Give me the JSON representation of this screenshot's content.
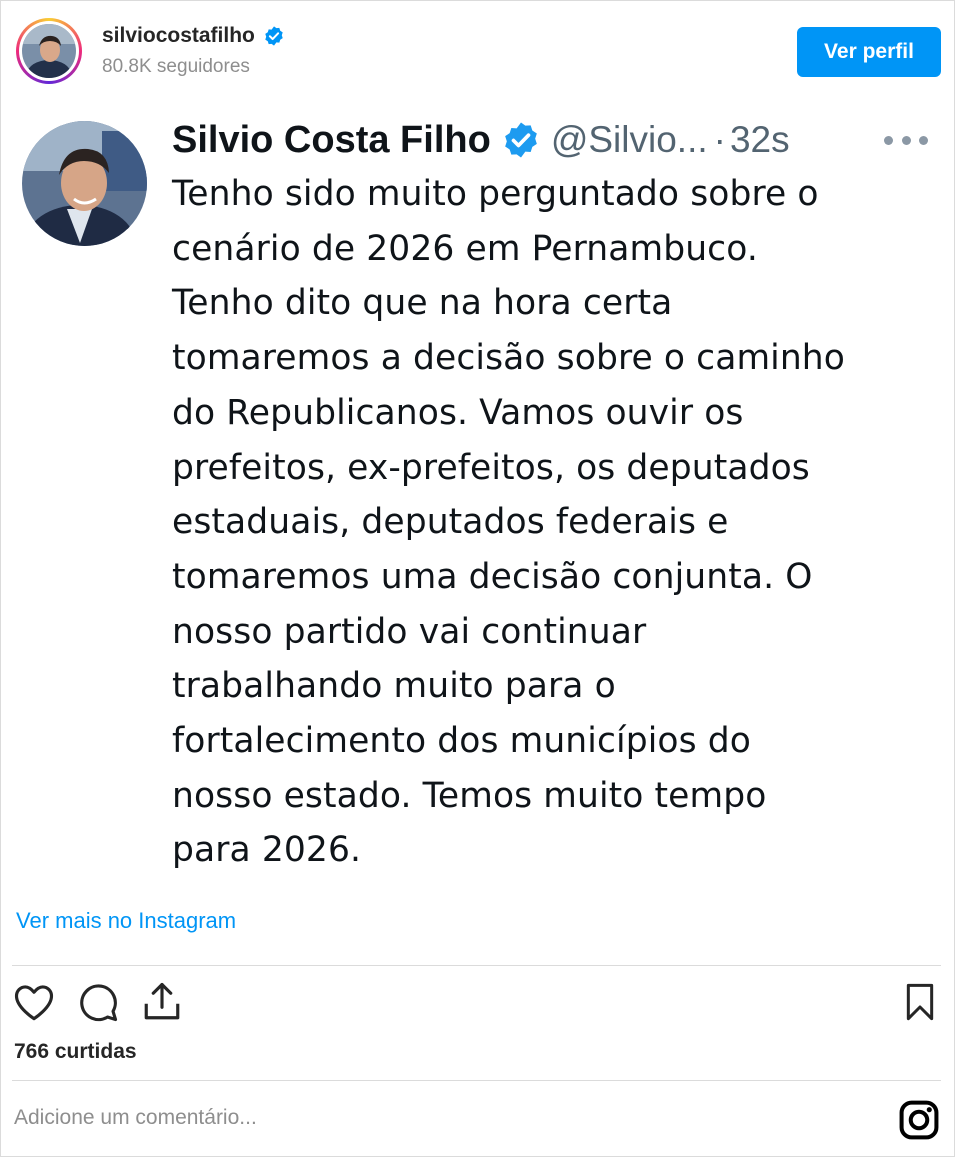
{
  "header": {
    "username": "silviocostafilho",
    "followers": "80.8K seguidores",
    "view_profile_label": "Ver perfil"
  },
  "tweet": {
    "display_name": "Silvio Costa Filho",
    "handle": "@Silvio...",
    "separator": "·",
    "time": "32s",
    "text": "Tenho sido muito perguntado sobre o\ncenário de 2026 em Pernambuco.\nTenho dito que na hora certa\ntomaremos a decisão sobre o caminho\ndo Republicanos. Vamos ouvir os\nprefeitos, ex-prefeitos, os deputados\nestaduais, deputados federais e\ntomaremos uma decisão conjunta. O\nnosso partido vai continuar\ntrabalhando muito para o\nfortalecimento dos municípios do\nnosso estado. Temos muito tempo\npara 2026."
  },
  "footer": {
    "see_more": "Ver mais no Instagram",
    "likes": "766 curtidas",
    "comment_placeholder": "Adicione um comentário..."
  },
  "icons": {
    "verified": "verified-badge-icon",
    "more": "more-options-icon",
    "like": "heart-icon",
    "comment": "comment-icon",
    "share": "share-icon",
    "save": "bookmark-icon",
    "instagram": "instagram-logo-icon"
  },
  "colors": {
    "accent": "#0095f6",
    "verified": "#1d9bf0",
    "muted": "#8e8e8e",
    "tweet_muted": "#536471"
  }
}
